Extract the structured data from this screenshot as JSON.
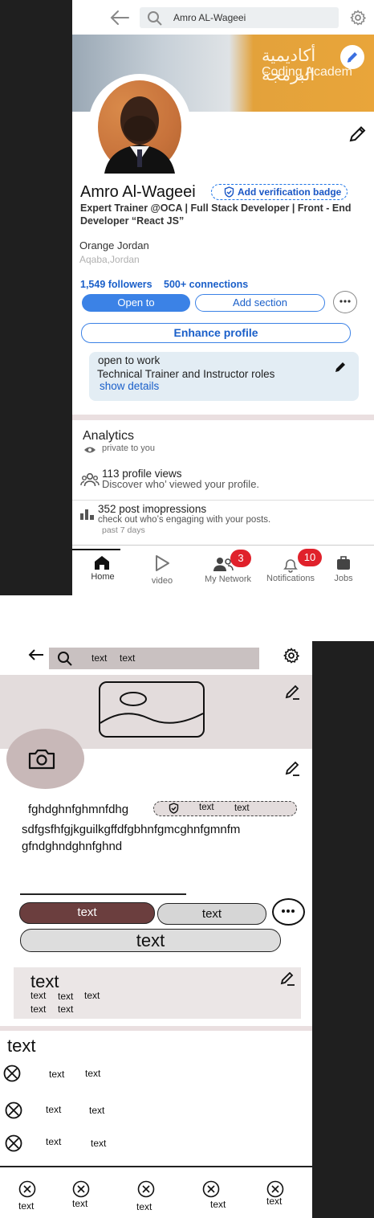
{
  "hifi": {
    "search": {
      "value": "Amro AL-Wageei"
    },
    "banner": {
      "arabic": "أكاديمية البرمجة",
      "english": "Coding Academ"
    },
    "profile": {
      "name": "Amro Al-Wageei",
      "verify_label": "Add verification badge",
      "headline": "Expert Trainer @OCA | Full Stack Developer | Front - End Developer “React JS”",
      "company": "Orange Jordan",
      "location": "Aqaba,Jordan",
      "followers": "1,549 followers",
      "connections": "500+ connections"
    },
    "buttons": {
      "open_to": "Open to",
      "add_section": "Add section",
      "enhance": "Enhance profile"
    },
    "open_to_work": {
      "title": "open to work",
      "roles": "Technical Trainer and Instructor roles",
      "link": "show details"
    },
    "analytics": {
      "title": "Analytics",
      "privacy": "private to you",
      "profile_views": "113 profile views",
      "profile_views_sub": "Discover who’ viewed your profile.",
      "post_impressions": "352 post imopressions",
      "post_impressions_sub": "check out who’s engaging with your posts.",
      "period": "past 7 days"
    },
    "nav": {
      "home": "Home",
      "video": "video",
      "network": "My Network",
      "network_badge": "3",
      "notifications": "Notifications",
      "notifications_badge": "10",
      "jobs": "Jobs"
    }
  },
  "wireframe": {
    "search": {
      "a": "text",
      "b": "text"
    },
    "name": "fghdghnfghmnfdhg",
    "badge": {
      "a": "text",
      "b": "text"
    },
    "long1": "sdfgsfhfgjkguilkgffdfgbhnfgmcghnfgmnfm",
    "long2": "gfndghndghnfghnd",
    "btn1": "text",
    "btn2": "text",
    "btn3": "text",
    "card": {
      "title": "text",
      "r1a": "text",
      "r1b": "text",
      "r1c": "text",
      "r2a": "text",
      "r2b": "text"
    },
    "section_title": "text",
    "rows": [
      {
        "a": "text",
        "b": "text"
      },
      {
        "a": "text",
        "b": "text"
      },
      {
        "a": "text",
        "b": "text"
      }
    ],
    "nav": [
      "text",
      "text",
      "text",
      "text",
      "text"
    ]
  },
  "colors": {
    "accent": "#3b82e6",
    "link": "#1a5fc9",
    "badge_red": "#e0212b",
    "wire_brown": "#6b3e3e"
  }
}
